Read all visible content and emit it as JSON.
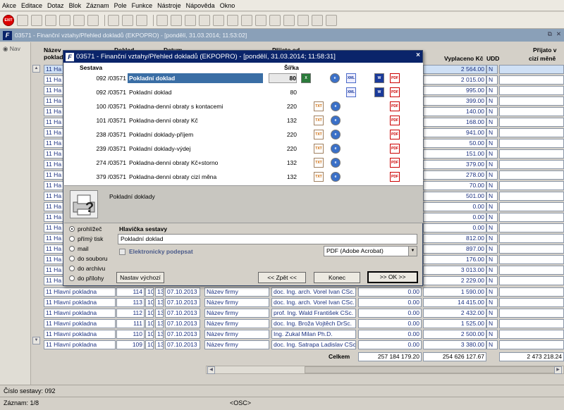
{
  "menu": [
    "Akce",
    "Editace",
    "Dotaz",
    "Blok",
    "Záznam",
    "Pole",
    "Funkce",
    "Nástroje",
    "Nápověda",
    "Okno"
  ],
  "exit_label": "EXIT",
  "window": {
    "title": "03571 - Finanční vztahy/Přehled dokladů (EKPOPRO) - [pondělí, 31.03.2014; 11:53:02]",
    "logo": "F"
  },
  "nav": {
    "label": "Nav"
  },
  "grid": {
    "headers": {
      "col1a": "Název",
      "col1b": "poklad",
      "col2": "Doklad",
      "col3": "Datum",
      "col4": "Přijato od",
      "paid": "Vyplaceno Kč",
      "udd": "UDD",
      "recv_a": "Přijato v",
      "recv_b": "cizí měně"
    },
    "amounts": [
      "2 564.00",
      "2 015.00",
      "995.00",
      "399.00",
      "140.00",
      "168.00",
      "941.00",
      "50.00",
      "151.00",
      "379.00",
      "278.00",
      "70.00",
      "501.00",
      "0.00",
      "0.00",
      "0.00",
      "812.00",
      "897.00",
      "176.00",
      "3 013.00",
      "2 229.00"
    ],
    "flag": "N",
    "cash": "11 Ha",
    "full_rows": [
      {
        "cash": "11 Hlavní pokladna",
        "doc": "114",
        "a": "10",
        "b": "13",
        "date": "07.10.2013",
        "firm": "Název firmy",
        "person": "doc. Ing. arch. Vorel Ivan CSc.",
        "amt": "0.00",
        "paid": "1 590.00",
        "flag": "N"
      },
      {
        "cash": "11 Hlavní pokladna",
        "doc": "113",
        "a": "10",
        "b": "13",
        "date": "07.10.2013",
        "firm": "Název firmy",
        "person": "doc. Ing. arch. Vorel Ivan CSc.",
        "amt": "0.00",
        "paid": "14 415.00",
        "flag": "N"
      },
      {
        "cash": "11 Hlavní pokladna",
        "doc": "112",
        "a": "10",
        "b": "13",
        "date": "07.10.2013",
        "firm": "Název firmy",
        "person": "prof. Ing. Wald František CSc.",
        "amt": "0.00",
        "paid": "2 432.00",
        "flag": "N"
      },
      {
        "cash": "11 Hlavní pokladna",
        "doc": "111",
        "a": "10",
        "b": "13",
        "date": "07.10.2013",
        "firm": "Název firmy",
        "person": "doc. Ing. Broža Vojtěch DrSc.",
        "amt": "0.00",
        "paid": "1 525.00",
        "flag": "N"
      },
      {
        "cash": "11 Hlavní pokladna",
        "doc": "110",
        "a": "10",
        "b": "13",
        "date": "07.10.2013",
        "firm": "Název firmy",
        "person": "Ing. Zukal Milan Ph.D.",
        "amt": "0.00",
        "paid": "2 500.00",
        "flag": "N"
      },
      {
        "cash": "11 Hlavní pokladna",
        "doc": "109",
        "a": "10",
        "b": "13",
        "date": "07.10.2013",
        "firm": "Název firmy",
        "person": "doc. Ing. Satrapa Ladislav CSc.",
        "amt": "0.00",
        "paid": "3 380.00",
        "flag": "N"
      }
    ],
    "total_label": "Celkem",
    "total_amt": "257 184 179.20",
    "total_paid": "254 626 127.67",
    "total_recv": "2 473 218.24"
  },
  "dialog": {
    "title": "03571 - Finanční vztahy/Přehled dokladů (EKPOPRO) - [pondělí, 31.03.2014; 11:58:31]",
    "logo": "F",
    "close": "×",
    "col_report": "Sestava",
    "col_width": "Šířka",
    "reports": [
      {
        "code": "092 /03571",
        "name": "Pokladní doklad",
        "width": "80",
        "sel": true,
        "icons": [
          "xls",
          "ie",
          "xml",
          "word",
          "pdf"
        ]
      },
      {
        "code": "092 /03571",
        "name": "Pokladní doklad",
        "width": "80",
        "icons": [
          "xml",
          "word",
          "pdf"
        ]
      },
      {
        "code": "100 /03571",
        "name": "Pokladna-denní obraty s kontacemi",
        "width": "220",
        "icons": [
          "txt",
          "ie",
          "pdf"
        ]
      },
      {
        "code": "101 /03571",
        "name": "Pokladna-denní obraty Kč",
        "width": "132",
        "icons": [
          "txt",
          "ie",
          "pdf"
        ]
      },
      {
        "code": "238 /03571",
        "name": "Pokladní doklady-příjem",
        "width": "220",
        "icons": [
          "txt",
          "ie",
          "pdf"
        ]
      },
      {
        "code": "239 /03571",
        "name": "Pokladní doklady-výdej",
        "width": "220",
        "icons": [
          "txt",
          "ie",
          "pdf"
        ]
      },
      {
        "code": "274 /03571",
        "name": "Pokladna-denní obraty Kč+storno",
        "width": "132",
        "icons": [
          "txt",
          "ie",
          "pdf"
        ]
      },
      {
        "code": "379 /03571",
        "name": "Pokladna-denní obraty cizí měna",
        "width": "132",
        "icons": [
          "txt",
          "ie",
          "pdf"
        ]
      }
    ],
    "icon_labels": {
      "xls": "X",
      "ie": "e",
      "xml": "XML",
      "word": "W",
      "pdf": "PDF",
      "txt": "TXT"
    },
    "info": "Pokladní doklady",
    "outputs": [
      "prohlížeč",
      "přímý tisk",
      "mail",
      "do souboru",
      "do archivu",
      "do přílohy"
    ],
    "header_label": "Hlavička sestavy",
    "header_value": "Pokladní doklad",
    "esign": "Elektronicky podepsat",
    "format": "PDF (Adobe Acrobat)",
    "btn_default": "Nastav výchozí",
    "btn_back": "<< Zpět <<",
    "btn_end": "Konec",
    "btn_ok": ">> OK >>"
  },
  "status": {
    "report_no": "Číslo sestavy: 092",
    "record": "Záznam: 1/8",
    "osc": "<OSC>"
  }
}
